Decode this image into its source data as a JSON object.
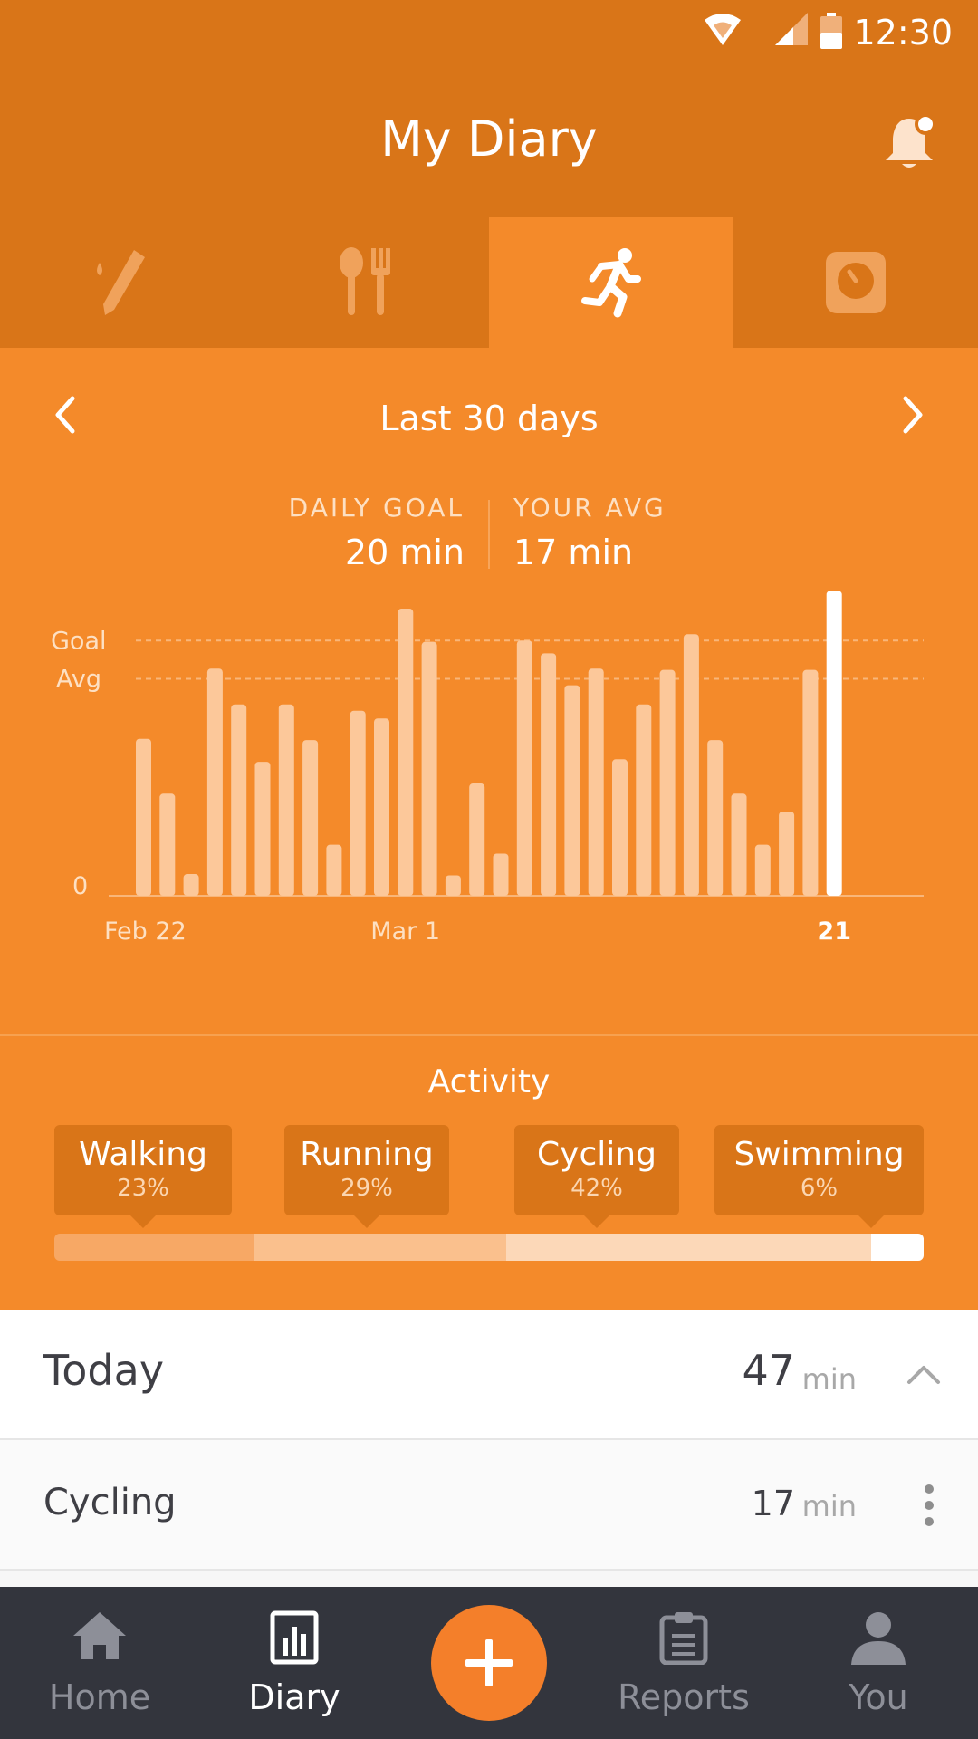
{
  "status": {
    "time": "12:30"
  },
  "header": {
    "title": "My Diary"
  },
  "tabs": [
    {
      "icon": "glucose-meter-icon",
      "active": false
    },
    {
      "icon": "food-utensils-icon",
      "active": false
    },
    {
      "icon": "running-icon",
      "active": true
    },
    {
      "icon": "scale-icon",
      "active": false
    }
  ],
  "range": {
    "label": "Last 30 days"
  },
  "stats": {
    "goal_label": "DAILY GOAL",
    "goal_value": "20 min",
    "avg_label": "YOUR AVG",
    "avg_value": "17 min"
  },
  "chart_data": {
    "type": "bar",
    "y_reference_labels": {
      "goal": "Goal",
      "avg": "Avg",
      "zero": "0"
    },
    "goal": 20,
    "avg": 17,
    "ylim": [
      0,
      23
    ],
    "x_tick_labels": [
      "Feb 22",
      "Mar 1",
      "21"
    ],
    "values": [
      12.3,
      8.0,
      1.7,
      17.8,
      15.0,
      10.5,
      15.0,
      12.2,
      4.0,
      14.5,
      13.9,
      22.5,
      19.9,
      1.6,
      8.8,
      3.3,
      20.0,
      19.0,
      16.5,
      17.8,
      10.7,
      15.0,
      17.7,
      20.5,
      12.2,
      8.0,
      4.0,
      6.6,
      17.7,
      23.9
    ],
    "highlight_index": 29,
    "colors": {
      "bar": "#fcc89a",
      "highlight": "#ffffff"
    }
  },
  "activity": {
    "title": "Activity",
    "items": [
      {
        "name": "Walking",
        "pct": "23%",
        "share": 0.23,
        "color": "#f7a865"
      },
      {
        "name": "Running",
        "pct": "29%",
        "share": 0.29,
        "color": "#fac08d"
      },
      {
        "name": "Cycling",
        "pct": "42%",
        "share": 0.42,
        "color": "#fcd8b8"
      },
      {
        "name": "Swimming",
        "pct": "6%",
        "share": 0.06,
        "color": "#ffffff"
      }
    ]
  },
  "today": {
    "label": "Today",
    "value": "47",
    "unit": "min"
  },
  "entries": [
    {
      "label": "Cycling",
      "value": "17",
      "unit": "min"
    }
  ],
  "bottom_nav": {
    "home": "Home",
    "diary": "Diary",
    "reports": "Reports",
    "you": "You"
  },
  "colors": {
    "header": "#d97518",
    "panel": "#f48a2a",
    "nav": "#33353d",
    "fab": "#f47f2a"
  }
}
